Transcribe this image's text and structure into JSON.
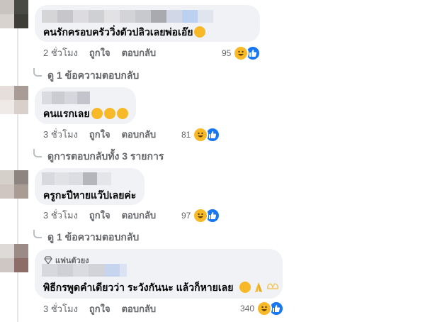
{
  "comments": [
    {
      "text": "คนรักครอบครัววิ่งตัวปลิวเลยพ่อเอ๊ย",
      "time": "2 ชั่วโมง",
      "like": "ถูกใจ",
      "reply": "ตอบกลับ",
      "reaction_count": "95",
      "replies_link": "ดู 1 ข้อความตอบกลับ",
      "emoji": [
        "rolling-laugh-emoji"
      ]
    },
    {
      "text": "คนแรกเลย",
      "time": "3 ชั่วโมง",
      "like": "ถูกใจ",
      "reply": "ตอบกลับ",
      "reaction_count": "81",
      "replies_link": "ดูการตอบกลับทั้ง 3 รายการ",
      "emoji": [
        "rolling-laugh-emoji",
        "rolling-laugh-emoji",
        "rolling-laugh-emoji"
      ]
    },
    {
      "text": "ครูกะปีหายแว๊ปเลยค่ะ",
      "time": "3 ชั่วโมง",
      "like": "ถูกใจ",
      "reply": "ตอบกลับ",
      "reaction_count": "97",
      "replies_link": "ดู 1 ข้อความตอบกลับ",
      "emoji": []
    },
    {
      "badge": "แฟนตัวยง",
      "text": "พิธีกรพูดคำเดียวว่า ระวังกันนะ แล้วก็หายเลย",
      "time": "3 ชั่วโมง",
      "like": "ถูกใจ",
      "reply": "ตอบกลับ",
      "reaction_count": "340",
      "emoji": [
        "grin-sweat-emoji",
        "folded-hands-emoji",
        "heart-hands-emoji"
      ]
    }
  ],
  "icons": {
    "laugh_reaction": "laugh-reaction-icon",
    "like_reaction": "like-reaction-icon",
    "badge": "diamond-icon"
  },
  "colors": {
    "bubble": "#f0f2f5",
    "meta_text": "#65676b",
    "like_blue": "#1877f2",
    "laugh_yellow": "#f7b928"
  }
}
